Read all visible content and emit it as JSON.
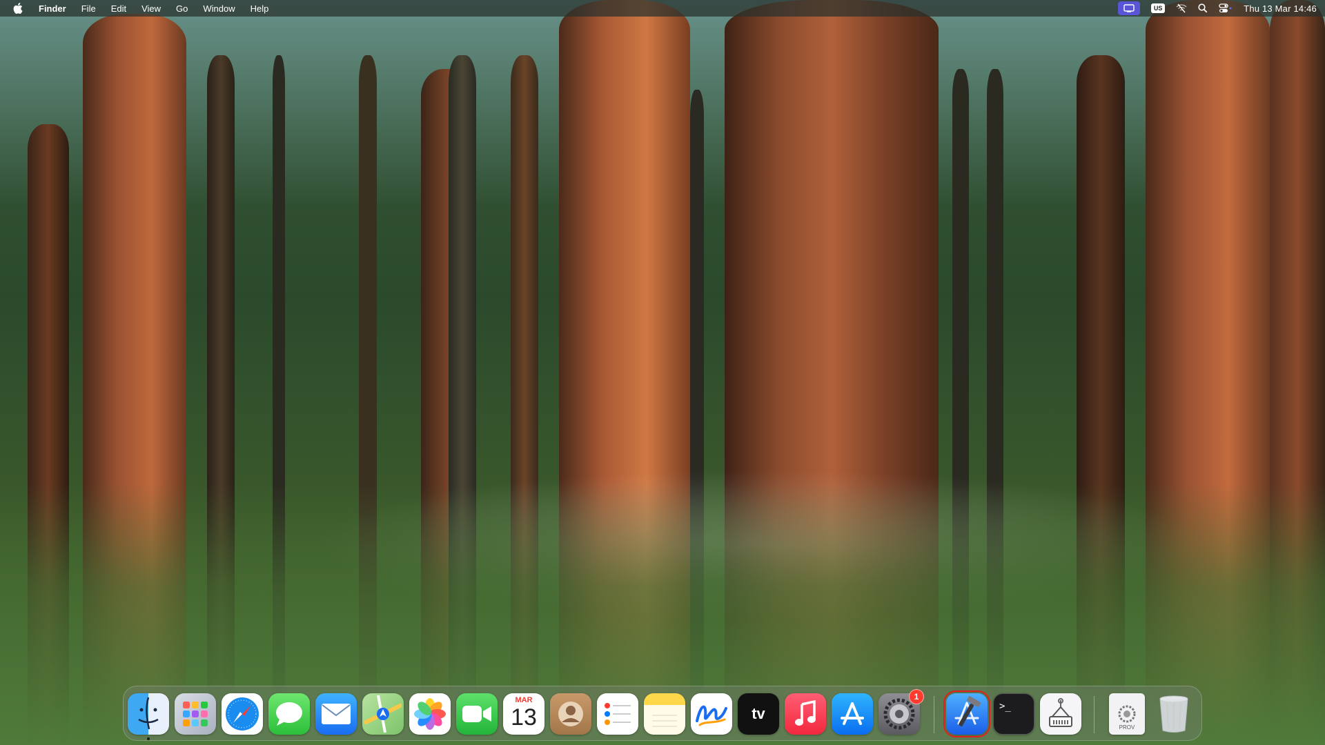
{
  "menubar": {
    "apple_icon": "apple-logo-icon",
    "app_name": "Finder",
    "menus": [
      "File",
      "Edit",
      "View",
      "Go",
      "Window",
      "Help"
    ],
    "status": {
      "screen_share_icon": "screen-mirroring-icon",
      "keyboard_layout": "US",
      "wifi_icon": "wifi-off-icon",
      "search_icon": "spotlight-search-icon",
      "control_center_icon": "control-center-icon",
      "clock": "Thu 13 Mar  14:46"
    }
  },
  "dock": {
    "apps": [
      {
        "name": "Finder",
        "icon": "finder-icon",
        "running": true
      },
      {
        "name": "Launchpad",
        "icon": "launchpad-icon"
      },
      {
        "name": "Safari",
        "icon": "safari-icon"
      },
      {
        "name": "Messages",
        "icon": "messages-icon"
      },
      {
        "name": "Mail",
        "icon": "mail-icon"
      },
      {
        "name": "Maps",
        "icon": "maps-icon"
      },
      {
        "name": "Photos",
        "icon": "photos-icon"
      },
      {
        "name": "FaceTime",
        "icon": "facetime-icon"
      },
      {
        "name": "Calendar",
        "icon": "calendar-icon",
        "month": "MAR",
        "day": "13"
      },
      {
        "name": "Contacts",
        "icon": "contacts-icon"
      },
      {
        "name": "Reminders",
        "icon": "reminders-icon"
      },
      {
        "name": "Notes",
        "icon": "notes-icon"
      },
      {
        "name": "Freeform",
        "icon": "freeform-icon"
      },
      {
        "name": "TV",
        "icon": "apple-tv-icon",
        "label": "tv"
      },
      {
        "name": "Music",
        "icon": "music-icon"
      },
      {
        "name": "App Store",
        "icon": "app-store-icon"
      },
      {
        "name": "System Settings",
        "icon": "system-settings-icon",
        "badge": "1"
      },
      {
        "name": "Xcode",
        "icon": "xcode-icon",
        "highlighted": true
      },
      {
        "name": "Terminal",
        "icon": "terminal-icon",
        "label": ">_"
      },
      {
        "name": "System Information",
        "icon": "system-information-icon"
      },
      {
        "name": "Provisioning Profile",
        "icon": "provisioning-profile-icon",
        "label": "PROV"
      },
      {
        "name": "Trash",
        "icon": "trash-icon"
      }
    ]
  },
  "colors": {
    "badge": "#ff3b30",
    "highlight": "#e0201b",
    "screen_share": "#5a55d6"
  }
}
